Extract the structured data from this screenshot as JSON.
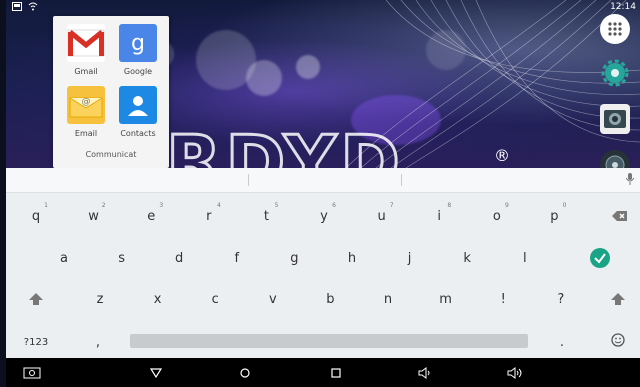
{
  "status": {
    "time": "12:14",
    "left_icons": [
      "screenshot-icon",
      "wifi-icon"
    ]
  },
  "folder": {
    "name": "Communicat",
    "apps": [
      {
        "label": "Gmail",
        "icon": "gmail-icon"
      },
      {
        "label": "Google",
        "icon": "google-search-icon"
      },
      {
        "label": "Email",
        "icon": "email-icon"
      },
      {
        "label": "Contacts",
        "icon": "contacts-icon"
      }
    ]
  },
  "wallpaper": {
    "registered_mark": "®"
  },
  "dock": [
    "app-drawer-icon",
    "settings-icon",
    "camera-icon",
    "media-icon"
  ],
  "keyboard": {
    "row1": [
      {
        "key": "q",
        "hint": "1"
      },
      {
        "key": "w",
        "hint": "2"
      },
      {
        "key": "e",
        "hint": "3"
      },
      {
        "key": "r",
        "hint": "4"
      },
      {
        "key": "t",
        "hint": "5"
      },
      {
        "key": "y",
        "hint": "6"
      },
      {
        "key": "u",
        "hint": "7"
      },
      {
        "key": "i",
        "hint": "8"
      },
      {
        "key": "o",
        "hint": "9"
      },
      {
        "key": "p",
        "hint": "0"
      }
    ],
    "row2": [
      "a",
      "s",
      "d",
      "f",
      "g",
      "h",
      "j",
      "k",
      "l"
    ],
    "row3": [
      "z",
      "x",
      "c",
      "v",
      "b",
      "n",
      "m",
      "!",
      "?"
    ],
    "symbols_label": "?123",
    "comma": ",",
    "period": "."
  },
  "colors": {
    "enter_key": "#1aa486",
    "keyboard_bg": "#eceff1",
    "folder_bg": "#f4f4f4"
  }
}
